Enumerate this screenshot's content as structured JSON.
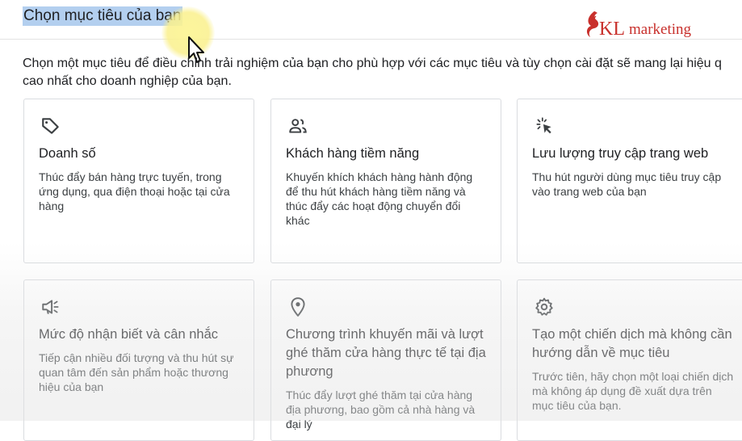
{
  "header": {
    "title": "Chọn mục tiêu của bạn",
    "logo_kl": "KL",
    "logo_marketing": "marketing",
    "logo_color": "#c8302c"
  },
  "description": {
    "line1": "Chọn một mục tiêu để điều chỉnh trải nghiệm của bạn cho phù hợp với các mục tiêu và tùy chọn cài đặt sẽ mang lại hiệu q",
    "line2": "cao nhất cho doanh nghiệp của bạn."
  },
  "goals": [
    {
      "icon": "tag-icon",
      "title": "Doanh số",
      "description": "Thúc đẩy bán hàng trực tuyến, trong ứng dụng, qua điện thoại hoặc tại cửa hàng"
    },
    {
      "icon": "people-icon",
      "title": "Khách hàng tiềm năng",
      "description": "Khuyến khích khách hàng hành động để thu hút khách hàng tiềm năng và thúc đẩy các hoạt động chuyển đổi khác"
    },
    {
      "icon": "cursor-click-icon",
      "title": "Lưu lượng truy cập trang web",
      "description": "Thu hút người dùng mục tiêu truy cập vào trang web của bạn"
    },
    {
      "icon": "megaphone-icon",
      "title": "Mức độ nhận biết và cân nhắc",
      "description": "Tiếp cận nhiều đối tượng và thu hút sự quan tâm đến sản phẩm hoặc thương hiệu của bạn"
    },
    {
      "icon": "location-pin-icon",
      "title": "Chương trình khuyến mãi và lượt ghé thăm cửa hàng thực tế tại địa phương",
      "description": "Thúc đẩy lượt ghé thăm tại cửa hàng địa phương, bao gồm cả nhà hàng và đại lý"
    },
    {
      "icon": "gear-icon",
      "title": "Tạo một chiến dịch mà không cần hướng dẫn về mục tiêu",
      "description": "Trước tiên, hãy chọn một loại chiến dịch mà không áp dụng đề xuất dựa trên mục tiêu của bạn."
    }
  ]
}
